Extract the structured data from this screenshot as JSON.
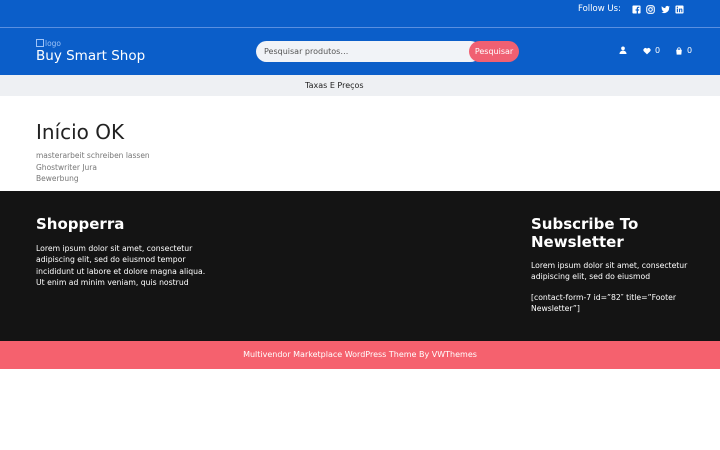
{
  "topbar": {
    "follow_label": "Follow Us:"
  },
  "social": [
    {
      "icon": "facebook-icon"
    },
    {
      "icon": "instagram-icon"
    },
    {
      "icon": "twitter-icon"
    },
    {
      "icon": "linkedin-icon"
    }
  ],
  "header": {
    "logo_alt": "logo",
    "site_title": "Buy Smart Shop",
    "search_placeholder": "Pesquisar produtos…",
    "search_button": "Pesquisar",
    "wishlist_count": "0",
    "cart_count": "0"
  },
  "nav": {
    "items": [
      {
        "label": "Taxas E Preços"
      }
    ]
  },
  "main": {
    "title": "Início OK",
    "links": [
      "masterarbeit schreiben lassen",
      "Ghostwriter Jura",
      "Bewerbung"
    ]
  },
  "footer": {
    "about_heading": "Shopperra",
    "about_text": "Lorem ipsum dolor sit amet, consectetur adipiscing elit, sed do eiusmod tempor incididunt ut labore et dolore magna aliqua. Ut enim ad minim veniam, quis nostrud",
    "newsletter_heading": "Subscribe To Newsletter",
    "newsletter_text": "Lorem ipsum dolor sit amet, consectetur adipiscing elit, sed do eiusmod",
    "shortcode": "[contact-form-7 id=”82″ title=”Footer Newsletter”]"
  },
  "copyright": "Multivendor Marketplace WordPress Theme By VWThemes",
  "colors": {
    "brand_blue": "#0b5ec9",
    "accent_pink": "#f5616e",
    "footer_bg": "#141414"
  }
}
